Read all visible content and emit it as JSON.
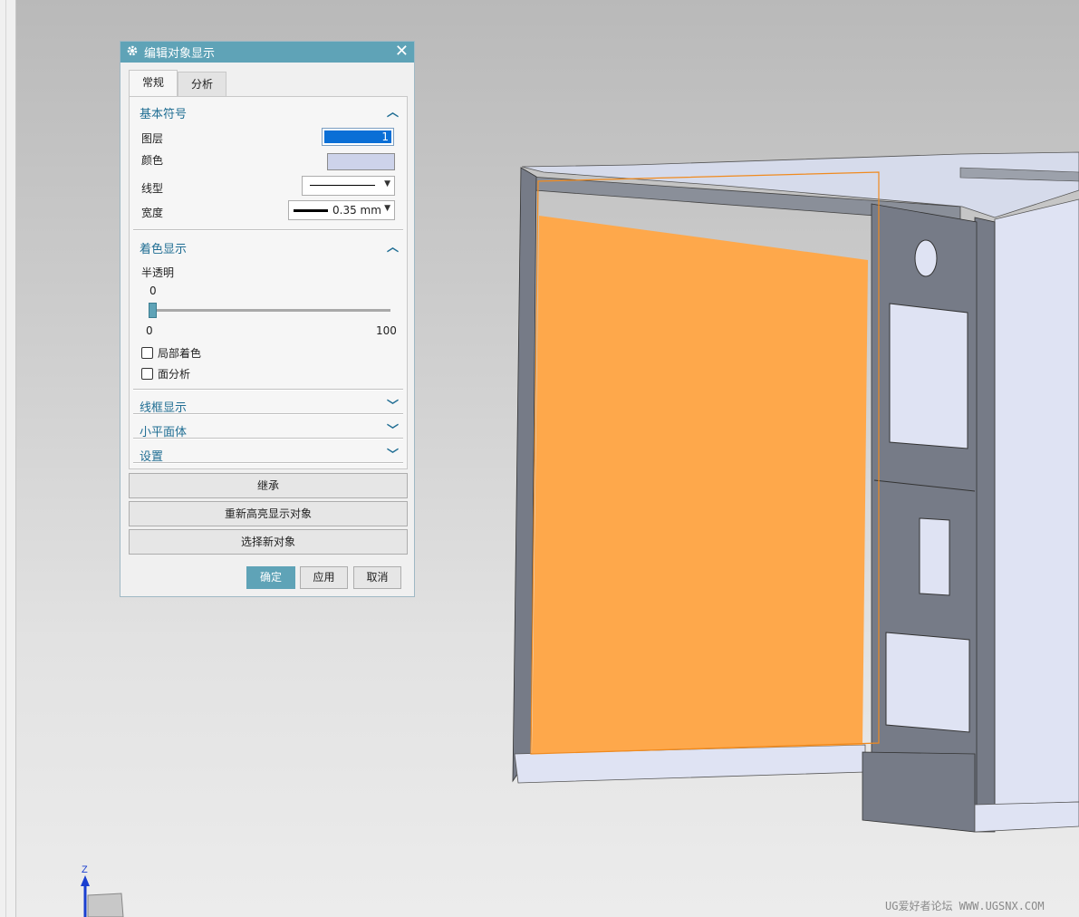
{
  "dialog": {
    "title": "编辑对象显示",
    "tabs": [
      "常规",
      "分析"
    ],
    "sections": {
      "basic_symbol": "基本符号",
      "shading": "着色显示",
      "wireframe": "线框显示",
      "facet": "小平面体",
      "settings": "设置"
    },
    "fields": {
      "layer_label": "图层",
      "layer_value": "1",
      "color_label": "颜色",
      "color_value": "#cdd3ea",
      "linetype_label": "线型",
      "width_label": "宽度",
      "width_value": "0.35 mm",
      "transparency_label": "半透明",
      "transparency_value": "0",
      "slider_min": "0",
      "slider_max": "100",
      "partial_shading": "局部着色",
      "face_analysis": "面分析"
    },
    "buttons": {
      "inherit": "继承",
      "reselect_highlight": "重新高亮显示对象",
      "select_new": "选择新对象",
      "ok": "确定",
      "apply": "应用",
      "cancel": "取消"
    }
  },
  "triad": {
    "axis_label": "Z"
  },
  "watermark": "UG爱好者论坛 WWW.UGSNX.COM",
  "colors": {
    "accent": "#5fa3b7",
    "highlight_face": "#fea84b",
    "cabinet_steel": "#767b87",
    "cabinet_face": "#dfe3f3"
  }
}
